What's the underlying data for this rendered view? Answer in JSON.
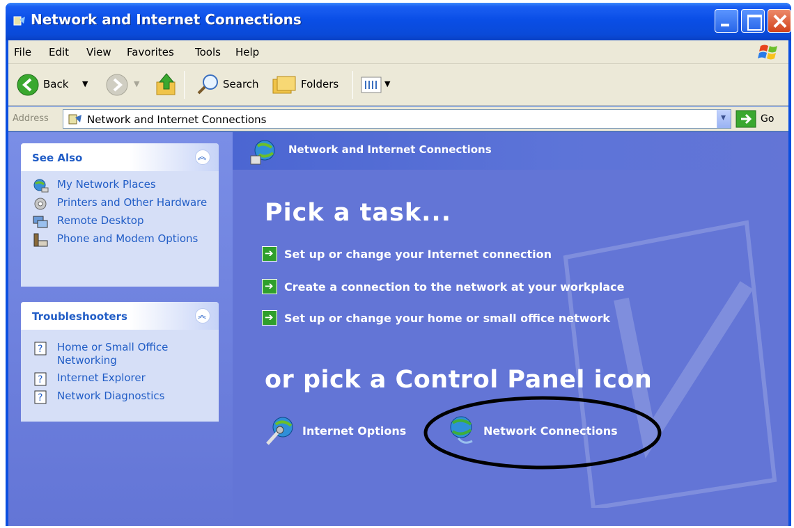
{
  "window": {
    "title": "Network and Internet Connections"
  },
  "menu": {
    "items": [
      "File",
      "Edit",
      "View",
      "Favorites",
      "Tools",
      "Help"
    ]
  },
  "toolbar": {
    "back_label": "Back",
    "search_label": "Search",
    "folders_label": "Folders"
  },
  "address": {
    "label": "Address",
    "value": "Network and Internet Connections",
    "go_label": "Go"
  },
  "see_also": {
    "title": "See Also",
    "items": [
      {
        "label": "My Network Places",
        "icon": "network-places-icon"
      },
      {
        "label": "Printers and Other Hardware",
        "icon": "printer-icon"
      },
      {
        "label": "Remote Desktop",
        "icon": "remote-desktop-icon"
      },
      {
        "label": "Phone and Modem Options",
        "icon": "phone-icon"
      }
    ]
  },
  "troubleshooters": {
    "title": "Troubleshooters",
    "items": [
      {
        "label": "Home or Small Office Networking",
        "icon": "help-icon"
      },
      {
        "label": "Internet Explorer",
        "icon": "help-icon"
      },
      {
        "label": "Network Diagnostics",
        "icon": "help-icon"
      }
    ]
  },
  "main": {
    "banner_title": "Network and Internet Connections",
    "pick_task": "Pick a task...",
    "tasks": [
      "Set up or change your Internet connection",
      "Create a connection to the network at your workplace",
      "Set up or change your home or small office network"
    ],
    "pick_icon": "or pick a Control Panel icon",
    "icons": [
      {
        "label": "Internet Options",
        "icon": "internet-options-icon"
      },
      {
        "label": "Network Connections",
        "icon": "network-connections-icon"
      }
    ]
  },
  "colors": {
    "title_bar": "#0a4ee6",
    "content_bg": "#6375d6",
    "link": "#215dc6",
    "task_arrow": "#2f9f2c"
  }
}
